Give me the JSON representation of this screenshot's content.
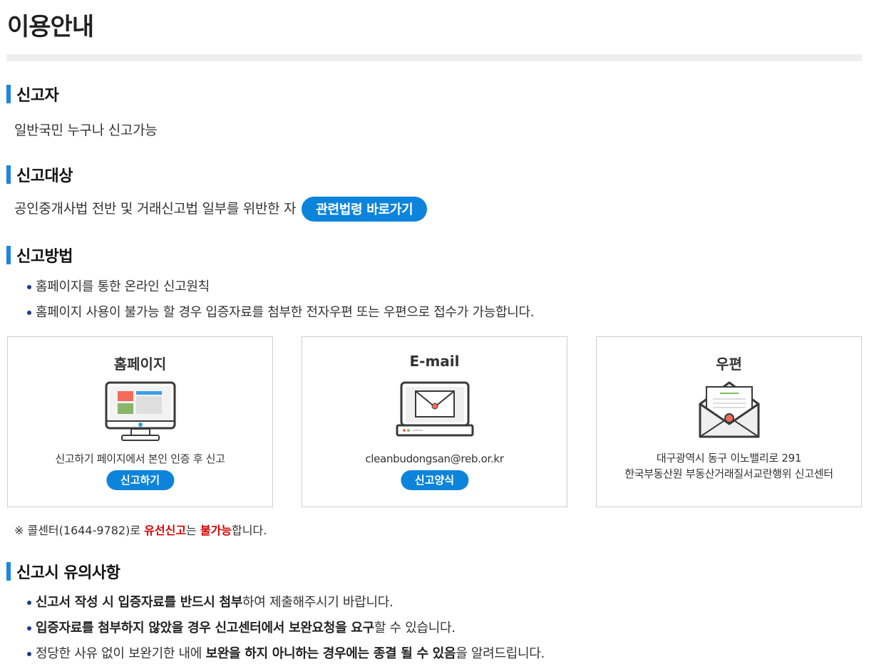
{
  "page": {
    "title": "이용안내"
  },
  "reporter": {
    "heading": "신고자",
    "text": "일반국민 누구나 신고가능"
  },
  "target": {
    "heading": "신고대상",
    "text": "공인중개사법 전반 및 거래신고법 일부를 위반한 자",
    "law_button": "관련법령 바로가기"
  },
  "method": {
    "heading": "신고방법",
    "bullets": [
      "홈페이지를 통한 온라인 신고원칙",
      "홈페이지 사용이 불가능 할 경우 입증자료를 첨부한 전자우편 또는 우편으로 접수가 가능합니다."
    ]
  },
  "cards": {
    "homepage": {
      "title": "홈페이지",
      "desc": "신고하기 페이지에서 본인 인증 후 신고",
      "button": "신고하기"
    },
    "email": {
      "title": "E-mail",
      "desc": "cleanbudongsan@reb.or.kr",
      "button": "신고양식"
    },
    "post": {
      "title": "우편",
      "desc_line1": "대구광역시 동구 이노밸리로 291",
      "desc_line2": "한국부동산원 부동산거래질서교란행위 신고센터"
    }
  },
  "callcenter_note": {
    "prefix": "※ 콜센터(1644-9782)로 ",
    "highlight1": "유선신고",
    "middle": "는 ",
    "highlight2": "불가능",
    "suffix": "합니다."
  },
  "cautions": {
    "heading": "신고시 유의사항",
    "items": [
      {
        "bold": "신고서 작성 시 입증자료를 반드시 첨부",
        "rest": "하여 제출해주시기 바랍니다."
      },
      {
        "bold": "입증자료를 첨부하지 않았을 경우 신고센터에서 보완요청을 요구",
        "rest": "할 수 있습니다."
      },
      {
        "pre": "정당한 사유 없이 보완기한 내에 ",
        "bold": "보완을 하지 아니하는 경우에는 종결 될 수 있음",
        "rest": "을 알려드립니다."
      }
    ]
  },
  "colors": {
    "accent": "#0d84dc",
    "section_mark": "#1b86e0",
    "warning": "#d60000"
  }
}
